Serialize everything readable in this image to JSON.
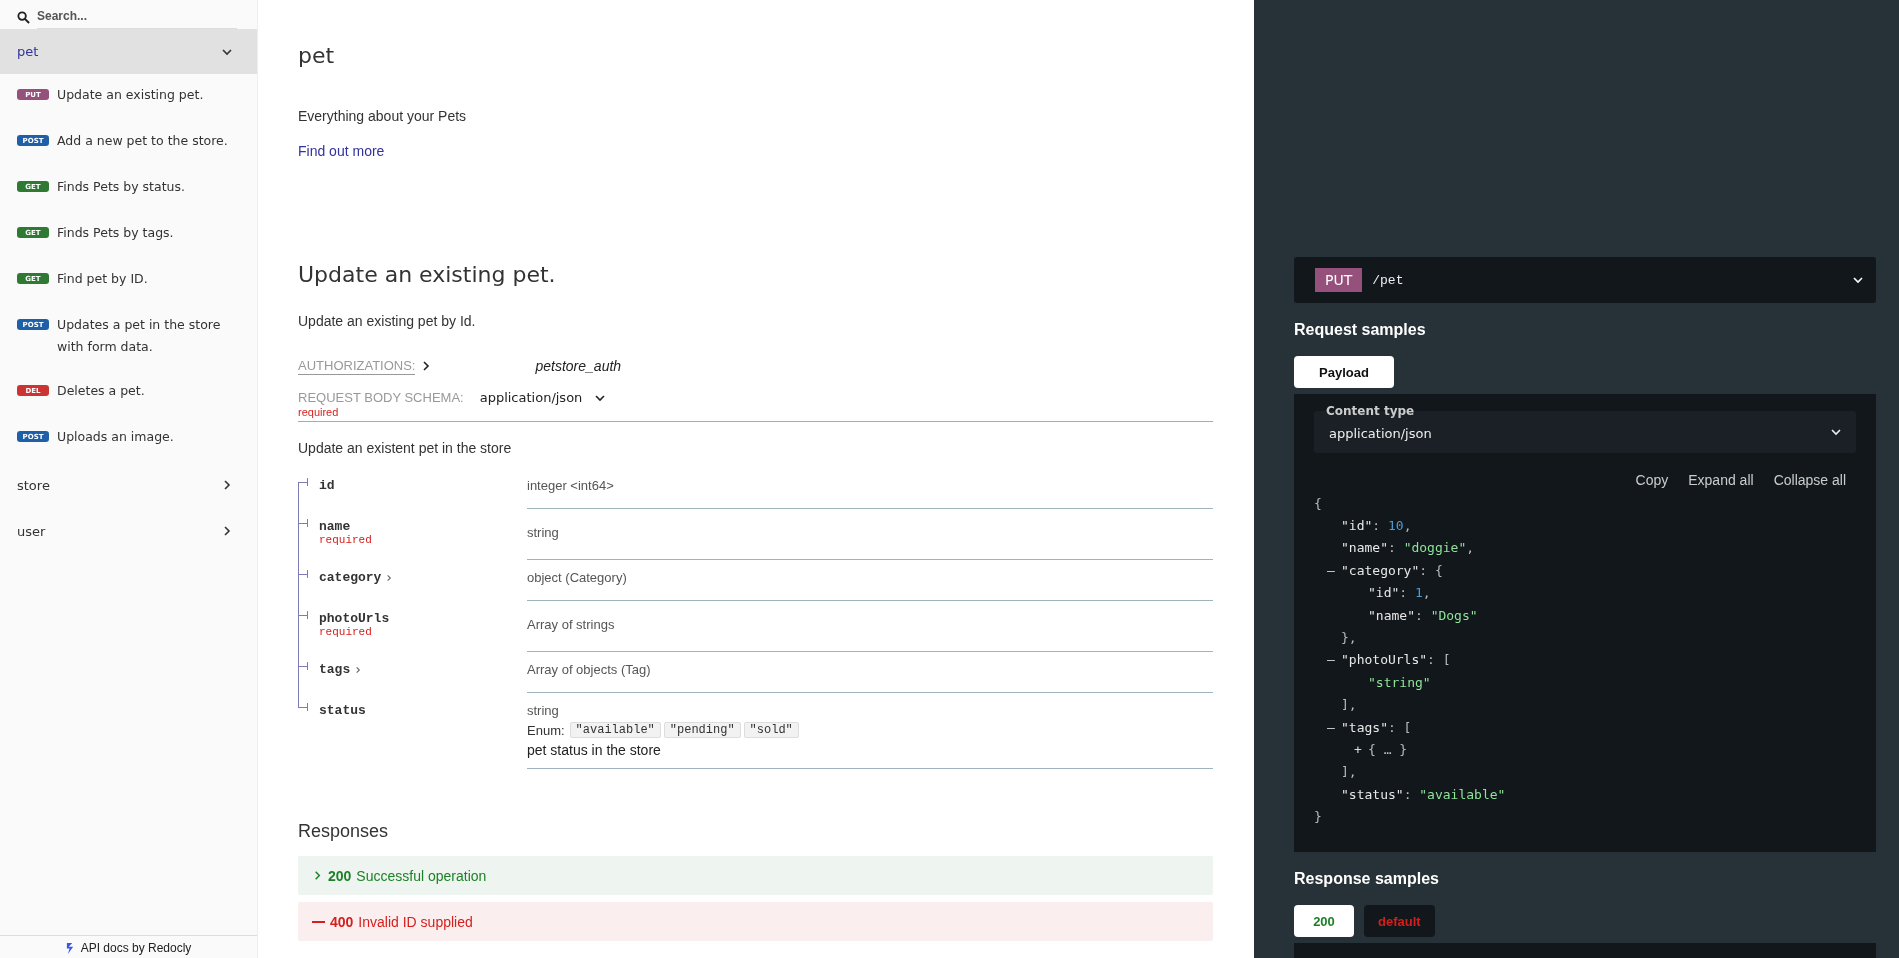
{
  "sidebar": {
    "search": {
      "placeholder": "Search..."
    },
    "groups": [
      {
        "label": "pet",
        "selected": true,
        "expanded": true,
        "items": [
          {
            "method": "PUT",
            "color": "#95507c",
            "label": "Update an existing pet."
          },
          {
            "method": "POST",
            "color": "#1f5fa7",
            "label": "Add a new pet to the store."
          },
          {
            "method": "GET",
            "color": "#2f7a33",
            "label": "Finds Pets by status."
          },
          {
            "method": "GET",
            "color": "#2f7a33",
            "label": "Finds Pets by tags."
          },
          {
            "method": "GET",
            "color": "#2f7a33",
            "label": "Find pet by ID."
          },
          {
            "method": "POST",
            "color": "#1f5fa7",
            "label": "Updates a pet in the store with form data."
          },
          {
            "method": "DEL",
            "color": "#cc3333",
            "label": "Deletes a pet."
          },
          {
            "method": "POST",
            "color": "#1f5fa7",
            "label": "Uploads an image."
          }
        ]
      },
      {
        "label": "store",
        "selected": false,
        "expanded": false
      },
      {
        "label": "user",
        "selected": false,
        "expanded": false
      }
    ],
    "footer": "API docs by Redocly"
  },
  "tag": {
    "title": "pet",
    "description": "Everything about your Pets",
    "link": "Find out more"
  },
  "operation": {
    "title": "Update an existing pet.",
    "description": "Update an existing pet by Id.",
    "authorizations": {
      "label": "AUTHORIZATIONS:",
      "value": "petstore_auth"
    },
    "request_body": {
      "label": "REQUEST BODY SCHEMA:",
      "content_type": "application/json",
      "required": "required",
      "description": "Update an existent pet in the store"
    },
    "fields": [
      {
        "name": "id",
        "expandable": false,
        "type": "integer <int64>"
      },
      {
        "name": "name",
        "required": "required",
        "expandable": false,
        "type": "string"
      },
      {
        "name": "category",
        "expandable": true,
        "type": "object (Category)"
      },
      {
        "name": "photoUrls",
        "required": "required",
        "expandable": false,
        "type": "Array of strings"
      },
      {
        "name": "tags",
        "expandable": true,
        "type": "Array of objects (Tag)"
      },
      {
        "name": "status",
        "expandable": false,
        "type": "string",
        "enum_label": "Enum:",
        "enum": [
          "\"available\"",
          "\"pending\"",
          "\"sold\""
        ],
        "description": "pet status in the store"
      }
    ],
    "responses_title": "Responses",
    "responses": [
      {
        "code": "200",
        "label": "Successful operation",
        "kind": "success",
        "expandable": true
      },
      {
        "code": "400",
        "label": "Invalid ID supplied",
        "kind": "error",
        "expandable": false
      }
    ]
  },
  "endpoint": {
    "method": "PUT",
    "color": "#95507c",
    "path": "/pet"
  },
  "request_samples": {
    "title": "Request samples",
    "tabs": [
      {
        "label": "Payload",
        "selected": true
      }
    ],
    "content_type_label": "Content type",
    "content_type": "application/json",
    "actions": [
      "Copy",
      "Expand all",
      "Collapse all"
    ],
    "code": {
      "tokens": [
        {
          "text": "{",
          "kind": "punct"
        }
      ],
      "children": [
        {
          "tokens": [
            {
              "text": "\"id\"",
              "kind": "key"
            },
            {
              "text": ": ",
              "kind": "punct"
            },
            {
              "text": "10",
              "kind": "number"
            },
            {
              "text": ",",
              "kind": "punct"
            }
          ]
        },
        {
          "tokens": [
            {
              "text": "\"name\"",
              "kind": "key"
            },
            {
              "text": ": ",
              "kind": "punct"
            },
            {
              "text": "\"doggie\"",
              "kind": "string"
            },
            {
              "text": ",",
              "kind": "punct"
            }
          ]
        },
        {
          "toggle": "–",
          "tokens": [
            {
              "text": "\"category\"",
              "kind": "key"
            },
            {
              "text": ": {",
              "kind": "punct"
            }
          ],
          "children": [
            {
              "tokens": [
                {
                  "text": "\"id\"",
                  "kind": "key"
                },
                {
                  "text": ": ",
                  "kind": "punct"
                },
                {
                  "text": "1",
                  "kind": "number"
                },
                {
                  "text": ",",
                  "kind": "punct"
                }
              ]
            },
            {
              "tokens": [
                {
                  "text": "\"name\"",
                  "kind": "key"
                },
                {
                  "text": ": ",
                  "kind": "punct"
                },
                {
                  "text": "\"Dogs\"",
                  "kind": "string"
                }
              ]
            }
          ],
          "close": [
            {
              "text": "},",
              "kind": "punct"
            }
          ]
        },
        {
          "toggle": "–",
          "tokens": [
            {
              "text": "\"photoUrls\"",
              "kind": "key"
            },
            {
              "text": ": [",
              "kind": "punct"
            }
          ],
          "children": [
            {
              "tokens": [
                {
                  "text": "\"string\"",
                  "kind": "string"
                }
              ]
            }
          ],
          "close": [
            {
              "text": "],",
              "kind": "punct"
            }
          ]
        },
        {
          "toggle": "–",
          "tokens": [
            {
              "text": "\"tags\"",
              "kind": "key"
            },
            {
              "text": ": [",
              "kind": "punct"
            }
          ],
          "children": [
            {
              "toggle": "+",
              "tokens": [
                {
                  "text": "{ … }",
                  "kind": "punct"
                }
              ]
            }
          ],
          "close": [
            {
              "text": "],",
              "kind": "punct"
            }
          ]
        },
        {
          "tokens": [
            {
              "text": "\"status\"",
              "kind": "key"
            },
            {
              "text": ": ",
              "kind": "punct"
            },
            {
              "text": "\"available\"",
              "kind": "string"
            }
          ]
        }
      ],
      "close": [
        {
          "text": "}",
          "kind": "punct"
        }
      ]
    }
  },
  "response_samples": {
    "title": "Response samples",
    "tabs": [
      {
        "label": "200",
        "kind": "success",
        "selected": true
      },
      {
        "label": "default",
        "kind": "error",
        "selected": false
      }
    ]
  }
}
